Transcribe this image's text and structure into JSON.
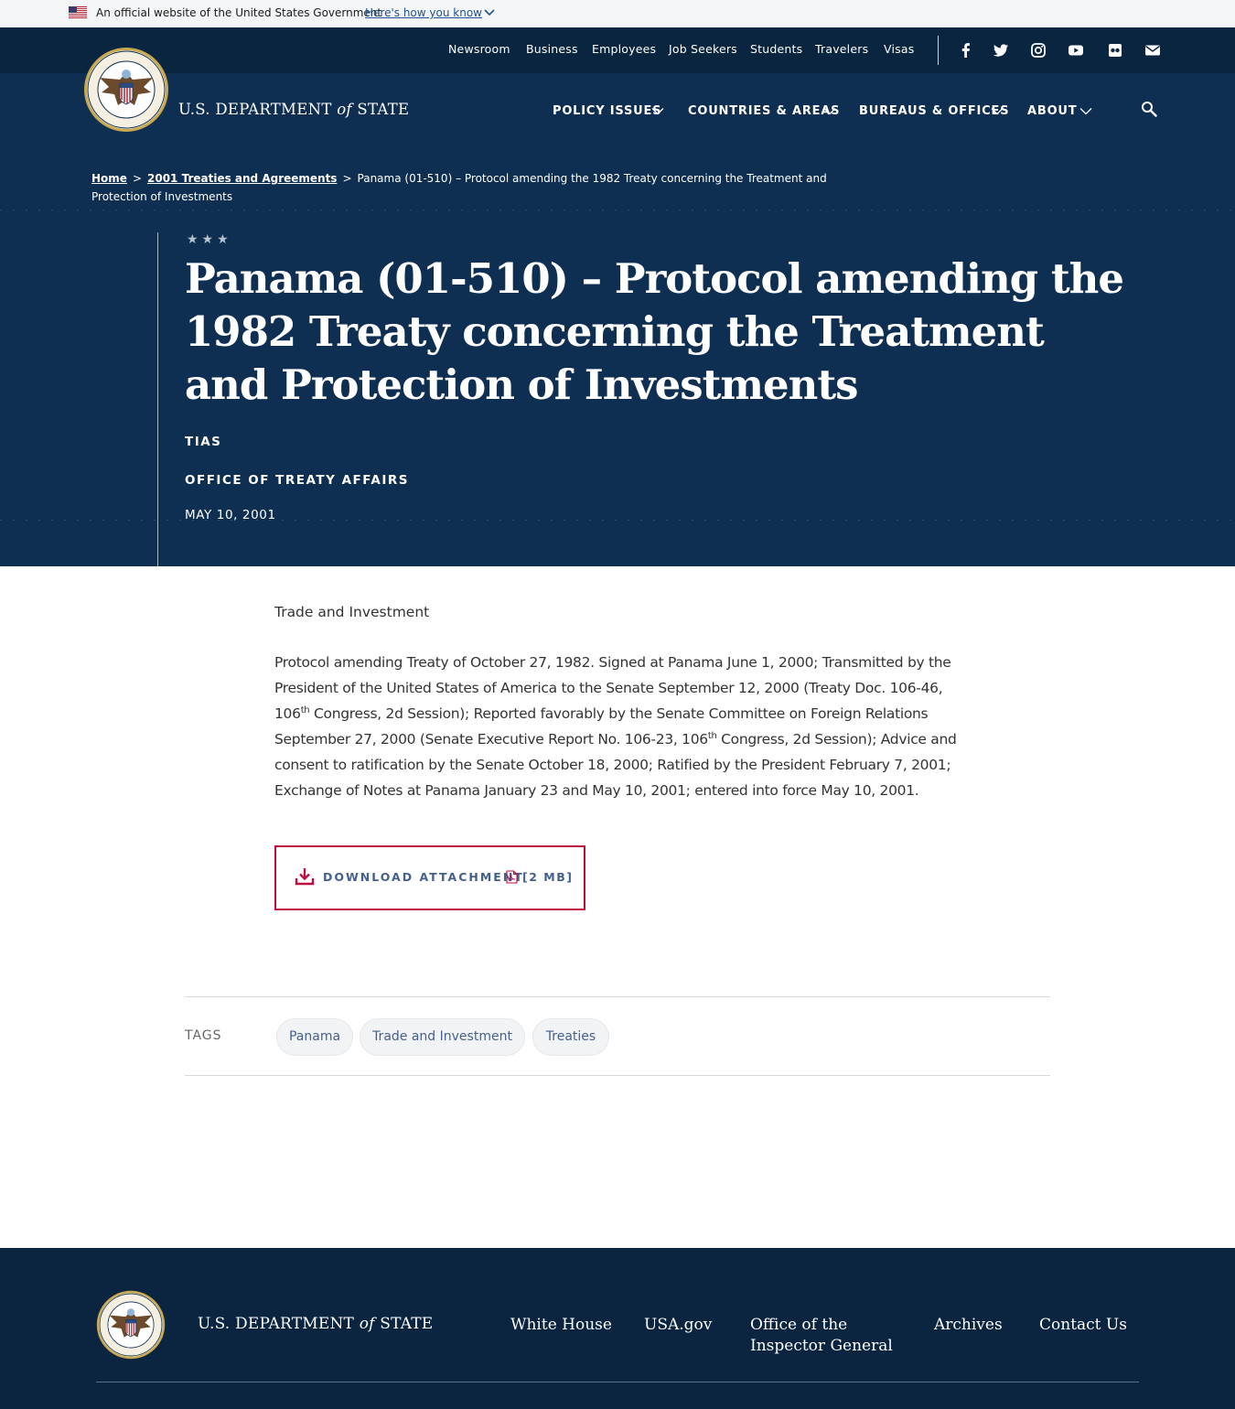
{
  "gov_banner": {
    "text": "An official website of the United States Government",
    "link": "Here's how you know"
  },
  "utility_nav": [
    "Newsroom",
    "Business",
    "Employees",
    "Job Seekers",
    "Students",
    "Travelers",
    "Visas"
  ],
  "social_icons": [
    "facebook-icon",
    "twitter-icon",
    "instagram-icon",
    "youtube-icon",
    "flickr-icon",
    "email-icon"
  ],
  "brand": {
    "pre": "U.S. DEPARTMENT",
    "of": "of",
    "post": "STATE"
  },
  "main_nav": [
    "POLICY ISSUES",
    "COUNTRIES & AREAS",
    "BUREAUS & OFFICES",
    "ABOUT"
  ],
  "breadcrumb": {
    "home": "Home",
    "parent": "2001 Treaties and Agreements",
    "separator": ">",
    "current": "Panama (01-510) – Protocol amending the 1982 Treaty concerning the Treatment and Protection of Investments"
  },
  "hero": {
    "stars": "★★★",
    "title": "Panama (01-510) – Protocol amending the 1982 Treaty concerning the Treatment and Protection of Investments",
    "series": "TIAS",
    "office": "OFFICE OF TREATY AFFAIRS",
    "date": "MAY 10, 2001"
  },
  "content": {
    "topic": "Trade and Investment",
    "para_a": "Protocol amending Treaty of October 27, 1982.  Signed at Panama June 1, 2000; Transmitted by the President of the United States of America to the Senate September 12, 2000 (Treaty Doc. 106-46, 106",
    "sup": "th",
    "para_b": " Congress, 2d Session); Reported favorably by the Senate Committee on Foreign Relations September 27, 2000 (Senate Executive Report No. 106-23, 106",
    "para_c": " Congress, 2d Session); Advice and consent to ratification by the Senate October 18, 2000; Ratified by the President February 7, 2001; Exchange of Notes at Panama January 23 and May 10, 2001;  entered into force May 10, 2001."
  },
  "download": {
    "label": "DOWNLOAD ATTACHMENT",
    "size": "[2 MB]"
  },
  "tags": {
    "label": "TAGS",
    "items": [
      "Panama",
      "Trade and Investment",
      "Treaties"
    ]
  },
  "footer": {
    "links": [
      "White House",
      "USA.gov",
      "Office of the Inspector General",
      "Archives",
      "Contact Us"
    ]
  },
  "colors": {
    "header_bg": "#0f2f52",
    "utility_bg": "#0a2540",
    "footer_bg": "#0b2440",
    "accent_red": "#bf0d3e",
    "link_blue": "#44608f"
  }
}
